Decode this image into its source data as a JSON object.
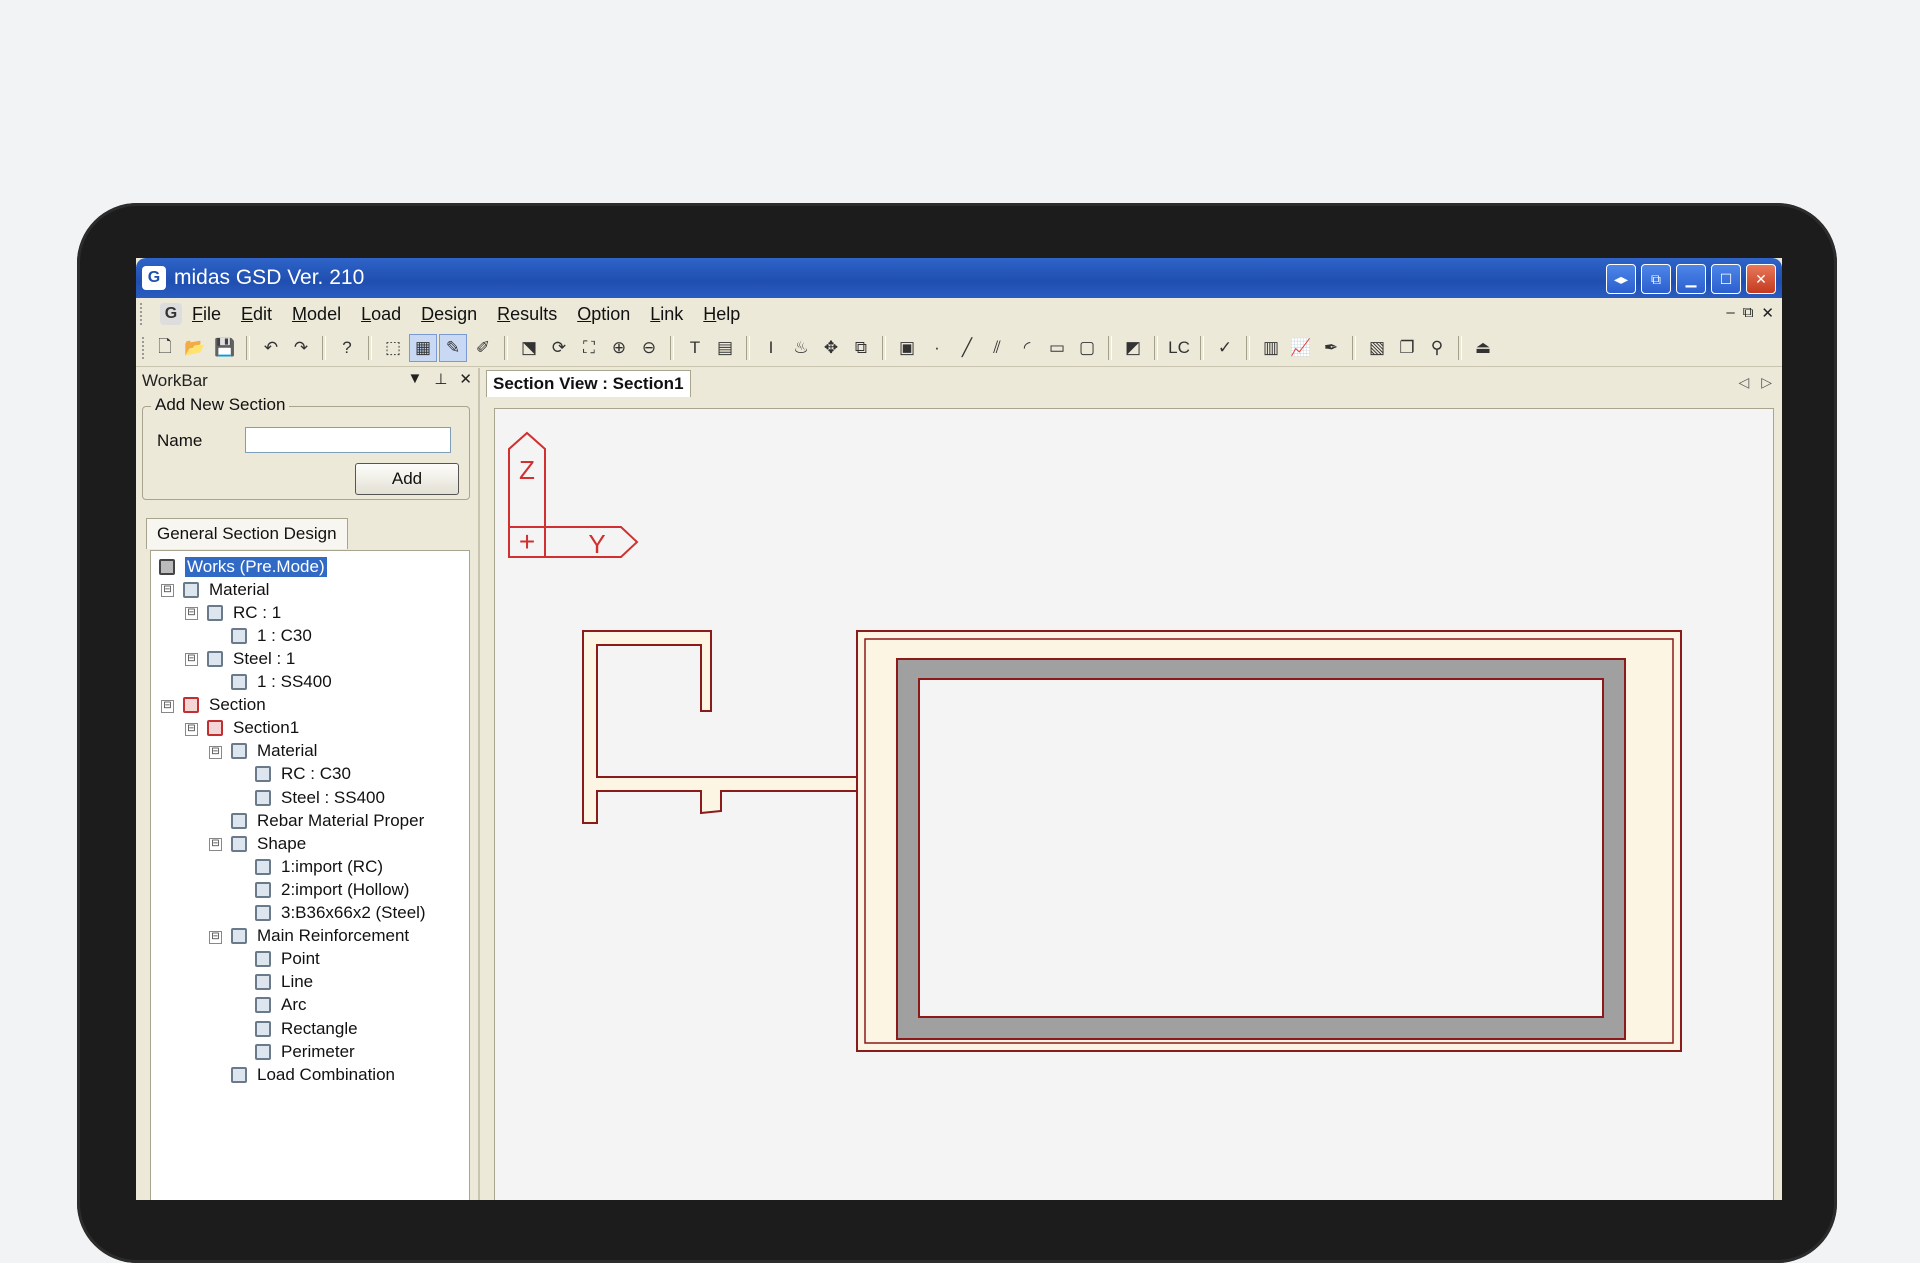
{
  "window": {
    "title": "midas GSD Ver. 210"
  },
  "menu": [
    "File",
    "Edit",
    "Model",
    "Load",
    "Design",
    "Results",
    "Option",
    "Link",
    "Help"
  ],
  "workbar": {
    "title": "WorkBar",
    "group_title": "Add New Section",
    "name_label": "Name",
    "name_value": "",
    "add_label": "Add",
    "tab_label": "General Section Design"
  },
  "tree": [
    {
      "label": "Works (Pre.Mode)",
      "depth": 0,
      "selected": true,
      "icon": "app-icon"
    },
    {
      "label": "Material",
      "depth": 1,
      "icon": "folder-icon",
      "expander": "⊟"
    },
    {
      "label": "RC : 1",
      "depth": 2,
      "icon": "folder-icon",
      "expander": "⊟"
    },
    {
      "label": "1 : C30",
      "depth": 3,
      "icon": "item-icon"
    },
    {
      "label": "Steel : 1",
      "depth": 2,
      "icon": "folder-icon",
      "expander": "⊟"
    },
    {
      "label": "1 : SS400",
      "depth": 3,
      "icon": "item-icon"
    },
    {
      "label": "Section",
      "depth": 1,
      "icon": "section-icon",
      "expander": "⊟"
    },
    {
      "label": "Section1",
      "depth": 2,
      "icon": "section-icon",
      "expander": "⊟"
    },
    {
      "label": "Material",
      "depth": 3,
      "icon": "folder-icon",
      "expander": "⊟"
    },
    {
      "label": "RC : C30",
      "depth": 4,
      "icon": "item-icon"
    },
    {
      "label": "Steel : SS400",
      "depth": 4,
      "icon": "item-icon"
    },
    {
      "label": "Rebar Material Proper",
      "depth": 3,
      "icon": "item-icon"
    },
    {
      "label": "Shape",
      "depth": 3,
      "icon": "folder-icon",
      "expander": "⊟"
    },
    {
      "label": "1:import (RC)",
      "depth": 4,
      "icon": "item-icon"
    },
    {
      "label": "2:import (Hollow)",
      "depth": 4,
      "icon": "item-icon"
    },
    {
      "label": "3:B36x66x2 (Steel)",
      "depth": 4,
      "icon": "item-icon"
    },
    {
      "label": "Main Reinforcement",
      "depth": 3,
      "icon": "folder-icon",
      "expander": "⊟"
    },
    {
      "label": "Point",
      "depth": 4,
      "icon": "item-icon"
    },
    {
      "label": "Line",
      "depth": 4,
      "icon": "item-icon"
    },
    {
      "label": "Arc",
      "depth": 4,
      "icon": "item-icon"
    },
    {
      "label": "Rectangle",
      "depth": 4,
      "icon": "item-icon"
    },
    {
      "label": "Perimeter",
      "depth": 4,
      "icon": "item-icon"
    },
    {
      "label": "Load Combination",
      "depth": 3,
      "icon": "item-icon"
    }
  ],
  "view": {
    "tab_label": "Section View : Section1",
    "axis_z": "Z",
    "axis_y": "Y",
    "origin": "+"
  },
  "toolbar_icons": [
    "new-icon",
    "open-icon",
    "save-icon",
    "sep",
    "undo-icon",
    "redo-icon",
    "sep",
    "help-icon",
    "sep",
    "select-icon",
    "grid-icon",
    "snap-icon",
    "snap2-icon",
    "sep",
    "zoom-window-icon",
    "rotate-icon",
    "fit-icon",
    "zoom-in-icon",
    "zoom-out-icon",
    "sep",
    "text-icon",
    "table-icon",
    "sep",
    "ibeam-icon",
    "fire-icon",
    "move-icon",
    "copy-icon",
    "sep",
    "node-icon",
    "point-icon",
    "line-icon",
    "line2-icon",
    "arc-icon",
    "rect-icon",
    "region-icon",
    "sep",
    "view-icon",
    "sep",
    "lc-icon",
    "sep",
    "check-icon",
    "sep",
    "chart-icon",
    "graph-icon",
    "pen-icon",
    "sep",
    "report-icon",
    "window-icon",
    "link-icon",
    "sep",
    "exit-icon"
  ],
  "colors": {
    "titlebar": "#1f4fb0",
    "section_outline": "#8b1a1a",
    "section_fill": "#fdf5e4",
    "steel_fill": "#a0a0a0",
    "axis": "#d03030"
  }
}
